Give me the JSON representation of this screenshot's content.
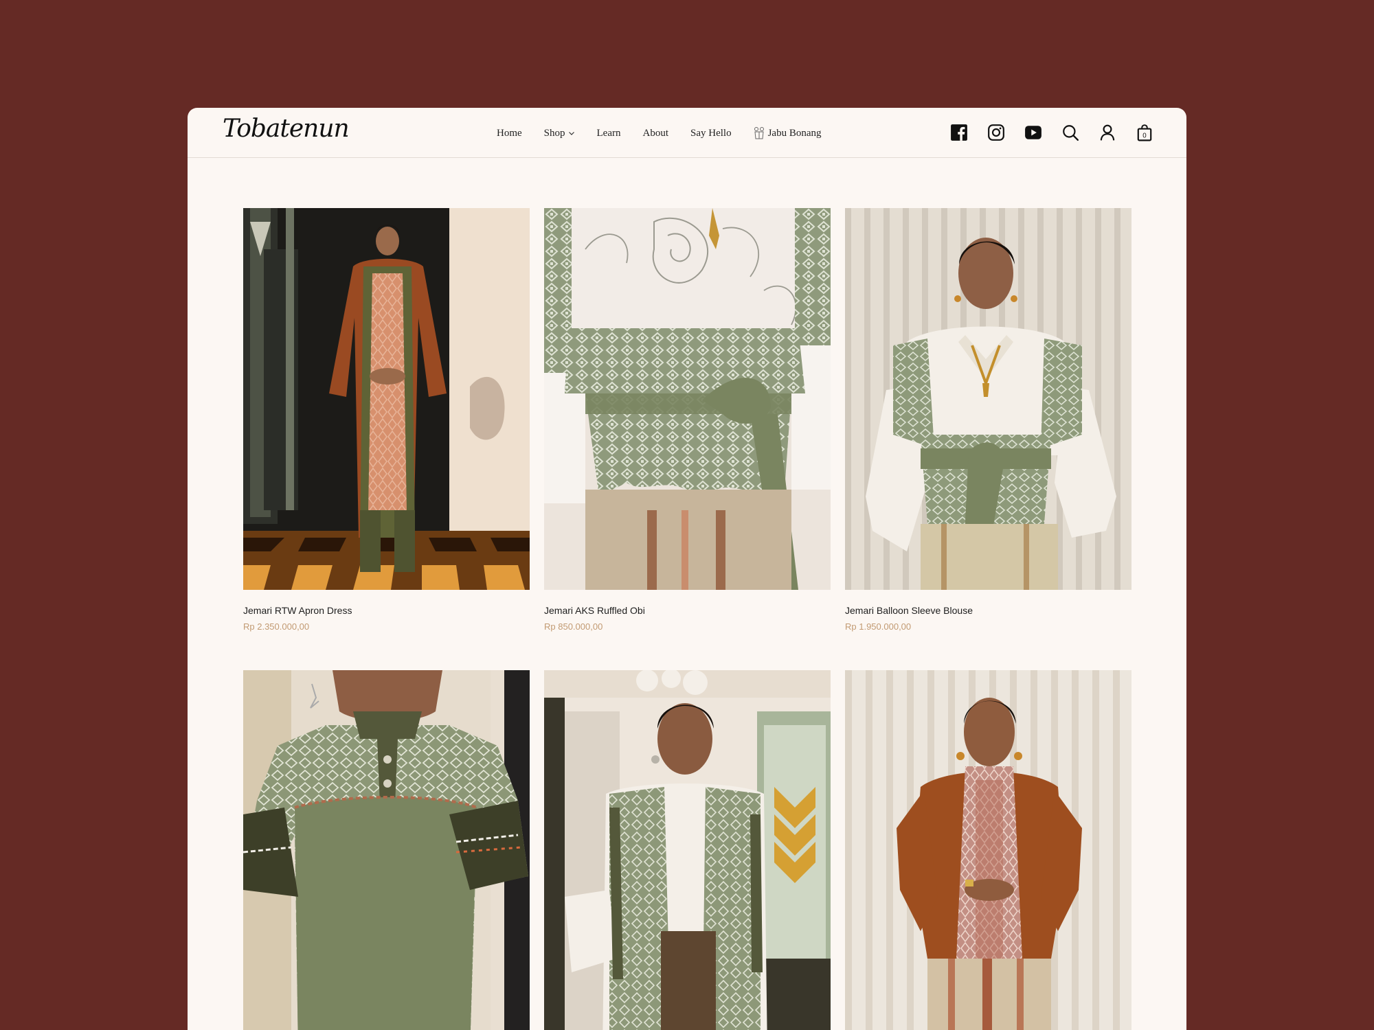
{
  "brand": {
    "logo_text": "Tobatenun"
  },
  "nav": {
    "items": [
      {
        "label": "Home"
      },
      {
        "label": "Shop"
      },
      {
        "label": "Learn"
      },
      {
        "label": "About"
      },
      {
        "label": "Say Hello"
      },
      {
        "label": "Jabu Bonang"
      }
    ]
  },
  "header_icons": [
    "facebook-icon",
    "instagram-icon",
    "youtube-icon",
    "search-icon",
    "account-icon",
    "cart-icon"
  ],
  "cart": {
    "count": "0"
  },
  "products": [
    {
      "title": "Jemari RTW Apron Dress",
      "price": "Rp 2.350.000,00"
    },
    {
      "title": "Jemari AKS Ruffled Obi",
      "price": "Rp 850.000,00"
    },
    {
      "title": "Jemari Balloon Sleeve Blouse",
      "price": "Rp 1.950.000,00"
    },
    {
      "title": "",
      "price": ""
    },
    {
      "title": "",
      "price": ""
    },
    {
      "title": "",
      "price": ""
    }
  ],
  "colors": {
    "background": "#652a25",
    "page": "#fcf7f3",
    "price": "#c29a72",
    "olive": "#7a8560",
    "rust": "#a4532c"
  }
}
